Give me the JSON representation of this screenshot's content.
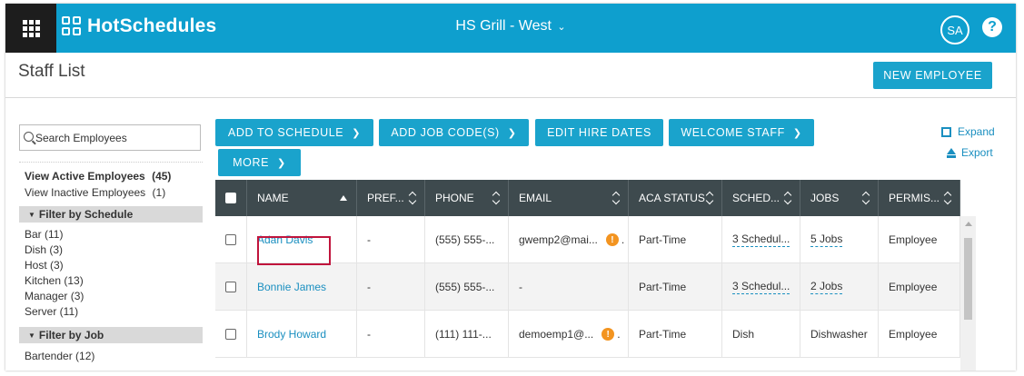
{
  "topbar": {
    "brand": "HotSchedules",
    "location": "HS Grill - West",
    "location_caret": "⌄",
    "user_initials": "SA",
    "help_label": "?"
  },
  "header": {
    "title": "Staff List",
    "new_employee_label": "NEW EMPLOYEE"
  },
  "sidebar": {
    "search_placeholder": "Search Employees",
    "view_active_label": "View Active Employees",
    "view_active_count": "(45)",
    "view_inactive_label": "View Inactive Employees",
    "view_inactive_count": "(1)",
    "filter_schedule_label": "Filter by Schedule",
    "schedules": [
      "Bar (11)",
      "Dish (3)",
      "Host (3)",
      "Kitchen (13)",
      "Manager (3)",
      "Server (11)"
    ],
    "filter_job_label": "Filter by Job",
    "jobs": [
      "Bartender (12)"
    ]
  },
  "actions": {
    "add_to_schedule": "ADD TO SCHEDULE",
    "add_job_codes": "ADD JOB CODE(S)",
    "edit_hire_dates": "EDIT HIRE DATES",
    "welcome_staff": "WELCOME STAFF",
    "more": "MORE",
    "expand": "Expand",
    "export": "Export"
  },
  "table": {
    "columns": [
      "NAME",
      "PREF...",
      "PHONE",
      "EMAIL",
      "ACA STATUS",
      "SCHED...",
      "JOBS",
      "PERMIS..."
    ],
    "rows": [
      {
        "name": "Adan Davis",
        "pref": "-",
        "phone": "(555) 555-...",
        "email": "gwemp2@mai...",
        "email_warning": "!",
        "email_trail": ".",
        "aca": "Part-Time",
        "schedules": "3 Schedul...",
        "jobs": "5 Jobs",
        "permission": "Employee"
      },
      {
        "name": "Bonnie James",
        "pref": "-",
        "phone": "(555) 555-...",
        "email": "-",
        "aca": "Part-Time",
        "schedules": "3 Schedul...",
        "jobs": "2 Jobs",
        "permission": "Employee"
      },
      {
        "name": "Brody Howard",
        "pref": "-",
        "phone": "(111) 111-...",
        "email": "demoemp1@...",
        "email_warning": "!",
        "email_trail": ".",
        "aca": "Part-Time",
        "schedules": "Dish",
        "jobs": "Dishwasher",
        "permission": "Employee"
      }
    ]
  },
  "colors": {
    "topbar": "#0e9fce",
    "button": "#1aa3cc",
    "table_header": "#3e4a4e",
    "link": "#1a8fc0",
    "warning": "#f39420",
    "highlight": "#c0143c"
  }
}
